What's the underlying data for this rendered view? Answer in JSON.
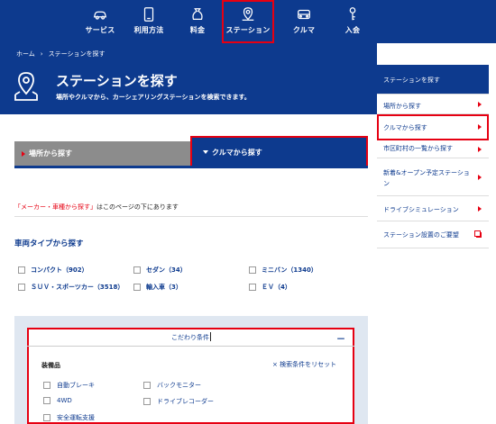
{
  "nav": {
    "items": [
      {
        "label": "サービス",
        "icon": "car-icon"
      },
      {
        "label": "利用方法",
        "icon": "phone-icon"
      },
      {
        "label": "料金",
        "icon": "money-bag-icon"
      },
      {
        "label": "ステーション",
        "icon": "map-pin-icon"
      },
      {
        "label": "クルマ",
        "icon": "car-front-icon"
      },
      {
        "label": "入会",
        "icon": "key-icon"
      }
    ],
    "active": "ステーション"
  },
  "breadcrumb": {
    "home": "ホーム",
    "separator": "›",
    "current": "ステーションを探す"
  },
  "hero": {
    "title": "ステーションを探す",
    "subtitle": "場所やクルマから、カーシェアリングステーションを検索できます。"
  },
  "sidebar": {
    "title": "ステーションを探す",
    "items": [
      "場所から探す",
      "クルマから探す",
      "市区町村の一覧から探す",
      "新着&オープン予定ステーション",
      "ドライブシミュレーション",
      "ステーション設置のご要望"
    ]
  },
  "tabs": {
    "place": "場所から探す",
    "car": "クルマから探す"
  },
  "note": {
    "red": "「メーカー・車種から探す」",
    "rest": "はこのページの下にあります"
  },
  "vehicle_section": {
    "title": "車両タイプから探す",
    "options": [
      "コンパクト（902）",
      "セダン（34）",
      "ミニバン（1340）",
      "ＳＵＶ・スポーツカー（3518）",
      "輸入車（3）",
      "ＥＶ（4）"
    ]
  },
  "filter_panel": {
    "title": "こだわり条件",
    "toggle": "－",
    "group_label": "装備品",
    "reset": "× 検索条件をリセット",
    "options": [
      "自動ブレーキ",
      "バックモニター",
      "4WD",
      "ドライブレコーダー",
      "安全運転支援"
    ]
  },
  "colors": {
    "brand": "#0d3a8e",
    "accent": "#e60012",
    "panel_bg": "#dfe7f1"
  }
}
